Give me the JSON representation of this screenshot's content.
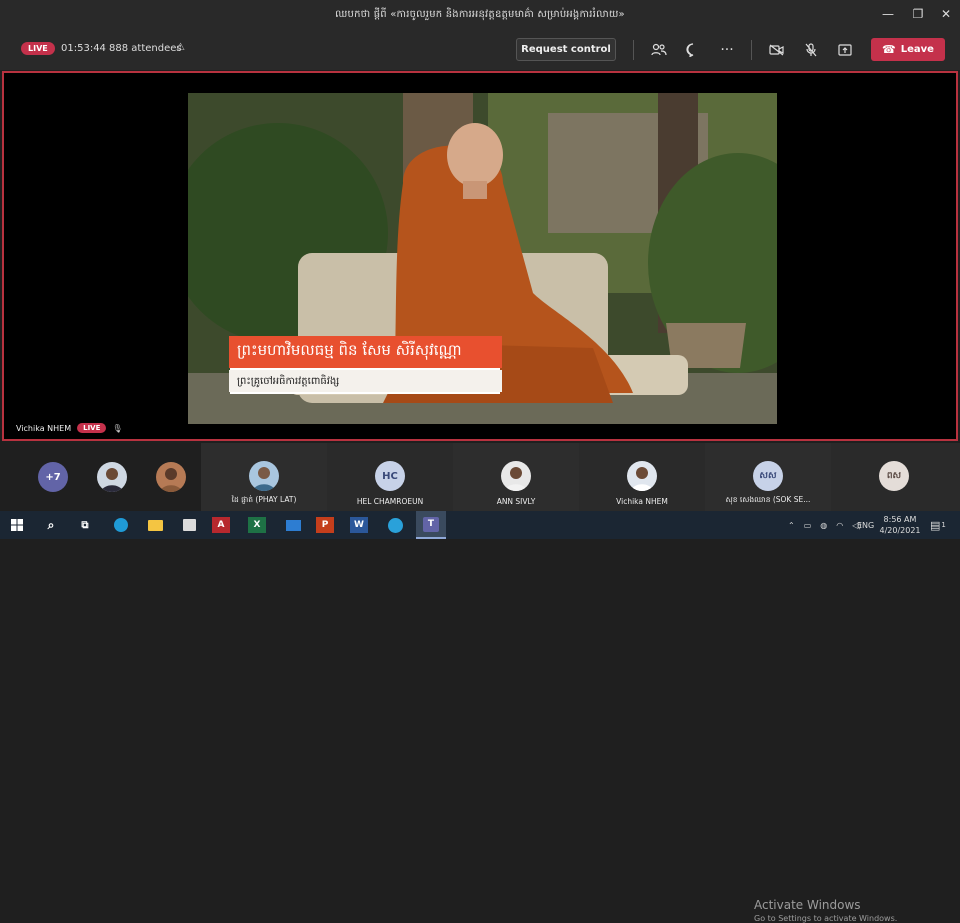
{
  "window": {
    "title": "ឈបកថា ផ្ដីពី «ការចូលរួមក និងការអនុវត្តឧត្តមមាគ៌ា សម្រាប់អង្គការរំលាយ»"
  },
  "toolbar": {
    "live_label": "LIVE",
    "elapsed": "01:53:44",
    "attendees": "888 attendees",
    "request_control_label": "Request control",
    "leave_label": "Leave"
  },
  "stage": {
    "presenter_name": "Vichika NHEM",
    "presenter_live_label": "LIVE",
    "lower_third": {
      "name": "ព្រះមហាវិមលធម្ម ពិន សែម សិរីសុវណ្ណោ",
      "subtitle": "ព្រះគ្រូចៅអធិការវត្តពោធិវង្ស"
    }
  },
  "gallery": {
    "overflow_count": "+7",
    "participants": [
      {
        "name": "ដៃ ផ្ញាត់ (PHAY LAT)",
        "initials": ""
      },
      {
        "name": "HEL CHAMROEUN",
        "initials": "HC"
      },
      {
        "name": "ANN SIVLY",
        "initials": ""
      },
      {
        "name": "Vichika NHEM",
        "initials": ""
      },
      {
        "name": "សុខ សេងឈាន (SOK SE...",
        "initials": "សស"
      },
      {
        "name": "",
        "initials": "ពស"
      }
    ]
  },
  "watermark": {
    "line1": "Activate Windows",
    "line2": "Go to Settings to activate Windows."
  },
  "taskbar": {
    "language": "ENG",
    "time": "8:56 AM",
    "date": "4/20/2021",
    "notification_count": "1"
  },
  "colors": {
    "accent_red": "#c4314b",
    "teams_purple": "#6264a7",
    "stage_border": "#b8323f"
  }
}
